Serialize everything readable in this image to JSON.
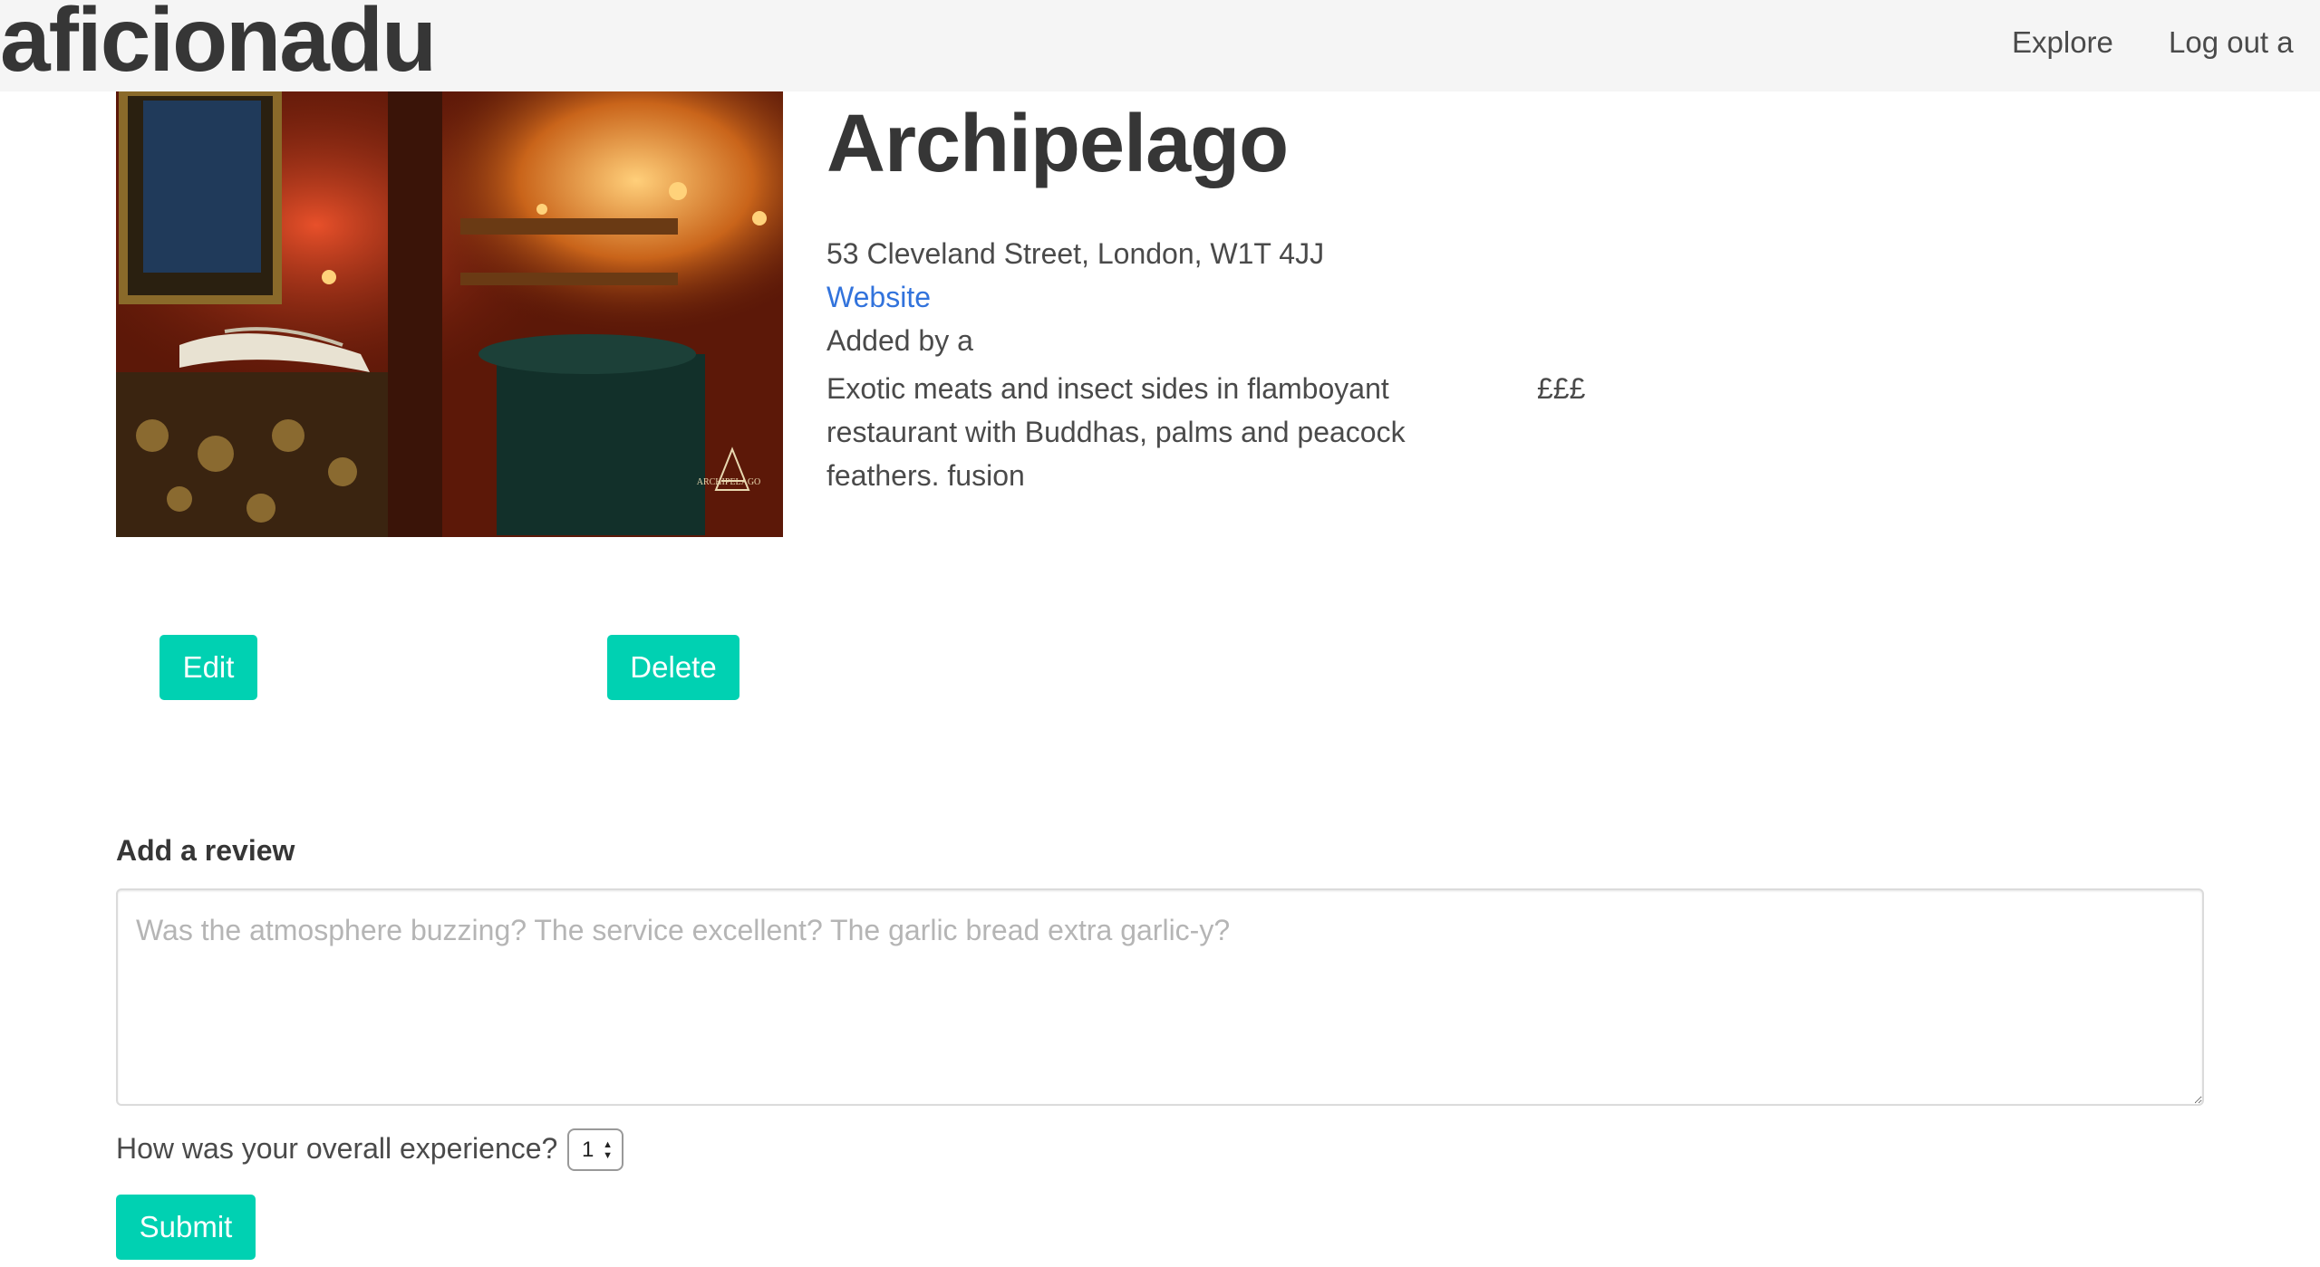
{
  "navbar": {
    "brand": "aficionadu",
    "links": [
      {
        "label": "Explore"
      },
      {
        "label": "Log out a"
      }
    ]
  },
  "restaurant": {
    "name": "Archipelago",
    "address": "53 Cleveland Street, London, W1T 4JJ",
    "website_label": "Website",
    "added_by": "Added by a",
    "description": "Exotic meats and insect sides in flamboyant restaurant with Buddhas, palms and peacock feathers. fusion",
    "price": "£££",
    "image_logo_text": "ARCHIPELAGO"
  },
  "actions": {
    "edit_label": "Edit",
    "delete_label": "Delete"
  },
  "review_form": {
    "heading": "Add a review",
    "placeholder": "Was the atmosphere buzzing? The service excellent? The garlic bread extra garlic-y?",
    "rating_question": "How was your overall experience?",
    "rating_value": "1",
    "submit_label": "Submit"
  },
  "colors": {
    "primary": "#00d1b2",
    "link": "#3273dc",
    "navbar_bg": "#f5f5f5",
    "text": "#363636"
  }
}
